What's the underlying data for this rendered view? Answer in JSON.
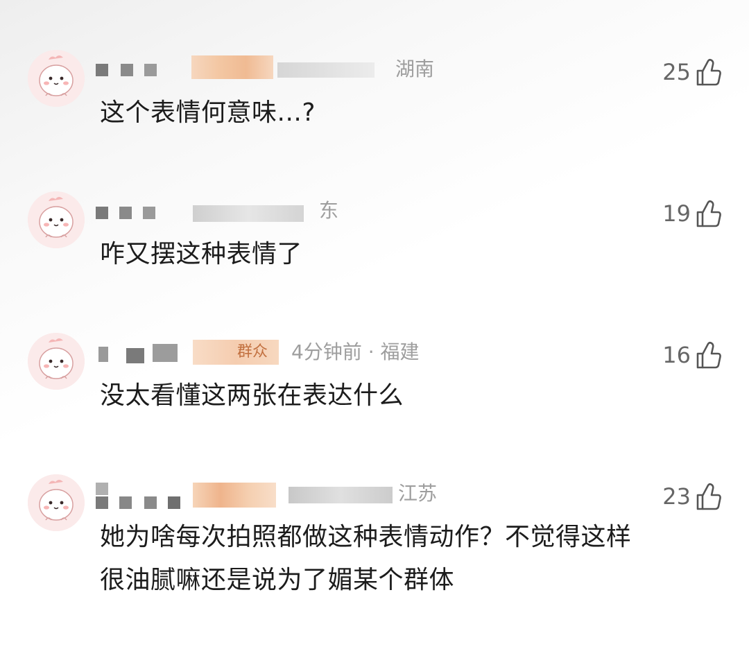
{
  "colors": {
    "text_primary": "#1c1c1c",
    "text_secondary": "#9e9e9e",
    "like_count": "#666666",
    "avatar_bg": "#f9e6e6"
  },
  "comments": [
    {
      "avatar_icon": "cartoon-avatar-icon",
      "meta_visible": "湖南",
      "text": "这个表情何意味...?",
      "likes": "25",
      "like_icon": "thumbs-up-icon"
    },
    {
      "avatar_icon": "cartoon-avatar-icon",
      "meta_visible": "东",
      "text": "咋又摆这种表情了",
      "likes": "19",
      "like_icon": "thumbs-up-icon"
    },
    {
      "avatar_icon": "cartoon-avatar-icon",
      "badge": "群众",
      "meta_visible": "4分钟前 · 福建",
      "text": "没太看懂这两张在表达什么",
      "likes": "16",
      "like_icon": "thumbs-up-icon"
    },
    {
      "avatar_icon": "cartoon-avatar-icon",
      "meta_visible": "江苏",
      "text_lines": [
        "她为啥每次拍照都做这种表情动作？不觉得这样",
        "很油腻嘛还是说为了媚某个群体"
      ],
      "likes": "23",
      "like_icon": "thumbs-up-icon"
    }
  ]
}
